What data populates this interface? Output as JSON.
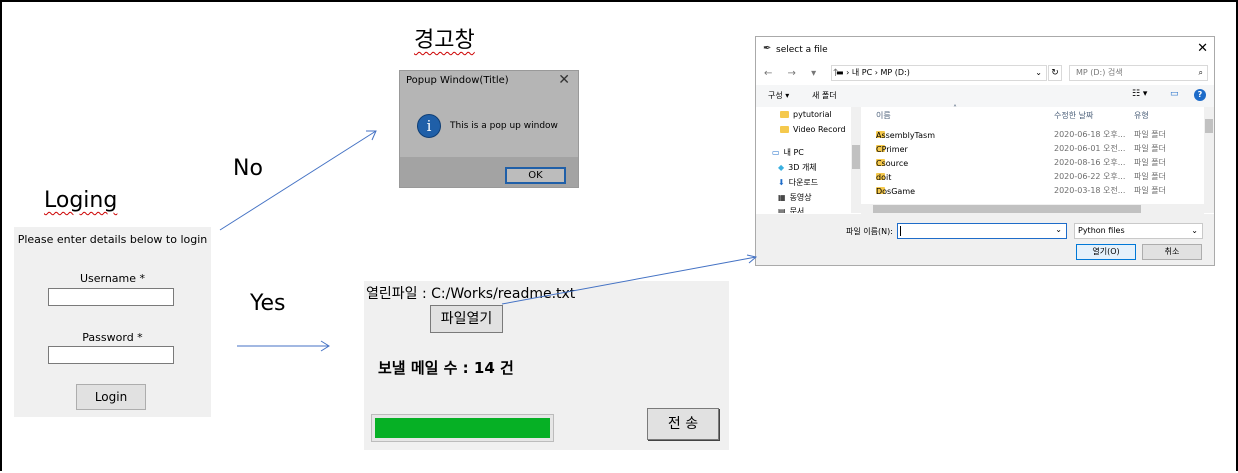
{
  "labels": {
    "login_heading": "Loging",
    "popup_heading": "경고창",
    "no": "No",
    "yes": "Yes"
  },
  "login": {
    "intro": "Please enter details below to login",
    "username_label": "Username *",
    "username_value": "",
    "password_label": "Password *",
    "password_value": "",
    "login_button": "Login"
  },
  "popup": {
    "title": "Popup Window(Title)",
    "close": "✕",
    "icon": "i",
    "message": "This is a pop up window",
    "ok_button": "OK"
  },
  "mail": {
    "opened_file": "열린파일 : C:/Works/readme.txt",
    "open_button": "파일열기",
    "mail_count": "보낼 메일 수 : 14 건",
    "progress": 1.0,
    "send_button": "전 송",
    "progress_color": "#06b025"
  },
  "file_dialog": {
    "title": "select a file",
    "close": "✕",
    "nav_icons": "← → ▾ ↑",
    "address": "▬ › 내 PC › MP (D:)",
    "search_placeholder": "MP (D:) 검색",
    "organize": "구성 ▾",
    "new_folder": "새 폴더",
    "help": "?",
    "nav_items": [
      "pytutorial",
      "Video Record",
      "내 PC",
      "3D 개체",
      "다운로드",
      "동영상",
      "문서"
    ],
    "columns": {
      "name": "이름",
      "date": "수정한 날짜",
      "type": "유형"
    },
    "rows": [
      {
        "name": "AssemblyTasm",
        "date": "2020-06-18 오후...",
        "type": "파일 폴더"
      },
      {
        "name": "CPrimer",
        "date": "2020-06-01 오전...",
        "type": "파일 폴더"
      },
      {
        "name": "Csource",
        "date": "2020-08-16 오후...",
        "type": "파일 폴더"
      },
      {
        "name": "doit",
        "date": "2020-06-22 오후...",
        "type": "파일 폴더"
      },
      {
        "name": "DosGame",
        "date": "2020-03-18 오전...",
        "type": "파일 폴더"
      }
    ],
    "filename_label": "파일 이름(N):",
    "filename_value": "",
    "filetype": "Python files",
    "open_button": "열기(O)",
    "cancel_button": "취소"
  },
  "colors": {
    "arrow": "#4472c4"
  }
}
